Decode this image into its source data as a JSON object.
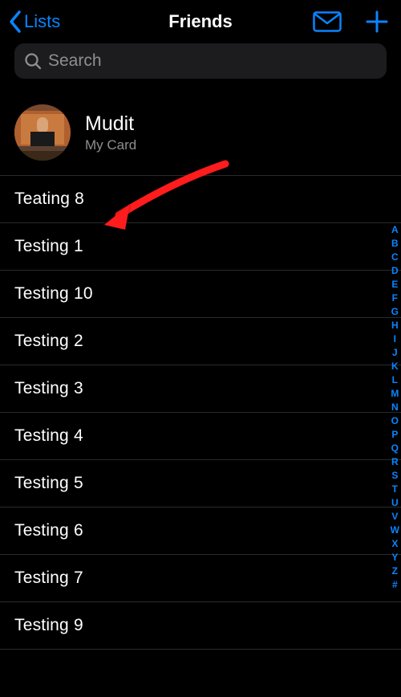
{
  "nav": {
    "back_label": "Lists",
    "title": "Friends"
  },
  "search": {
    "placeholder": "Search"
  },
  "my_card": {
    "name": "Mudit",
    "sub": "My Card"
  },
  "contacts": [
    {
      "name": "Teating 8"
    },
    {
      "name": "Testing 1"
    },
    {
      "name": "Testing 10"
    },
    {
      "name": "Testing 2"
    },
    {
      "name": "Testing 3"
    },
    {
      "name": "Testing 4"
    },
    {
      "name": "Testing 5"
    },
    {
      "name": "Testing 6"
    },
    {
      "name": "Testing 7"
    },
    {
      "name": "Testing 9"
    }
  ],
  "index_letters": [
    "A",
    "B",
    "C",
    "D",
    "E",
    "F",
    "G",
    "H",
    "I",
    "J",
    "K",
    "L",
    "M",
    "N",
    "O",
    "P",
    "Q",
    "R",
    "S",
    "T",
    "U",
    "V",
    "W",
    "X",
    "Y",
    "Z",
    "#"
  ]
}
